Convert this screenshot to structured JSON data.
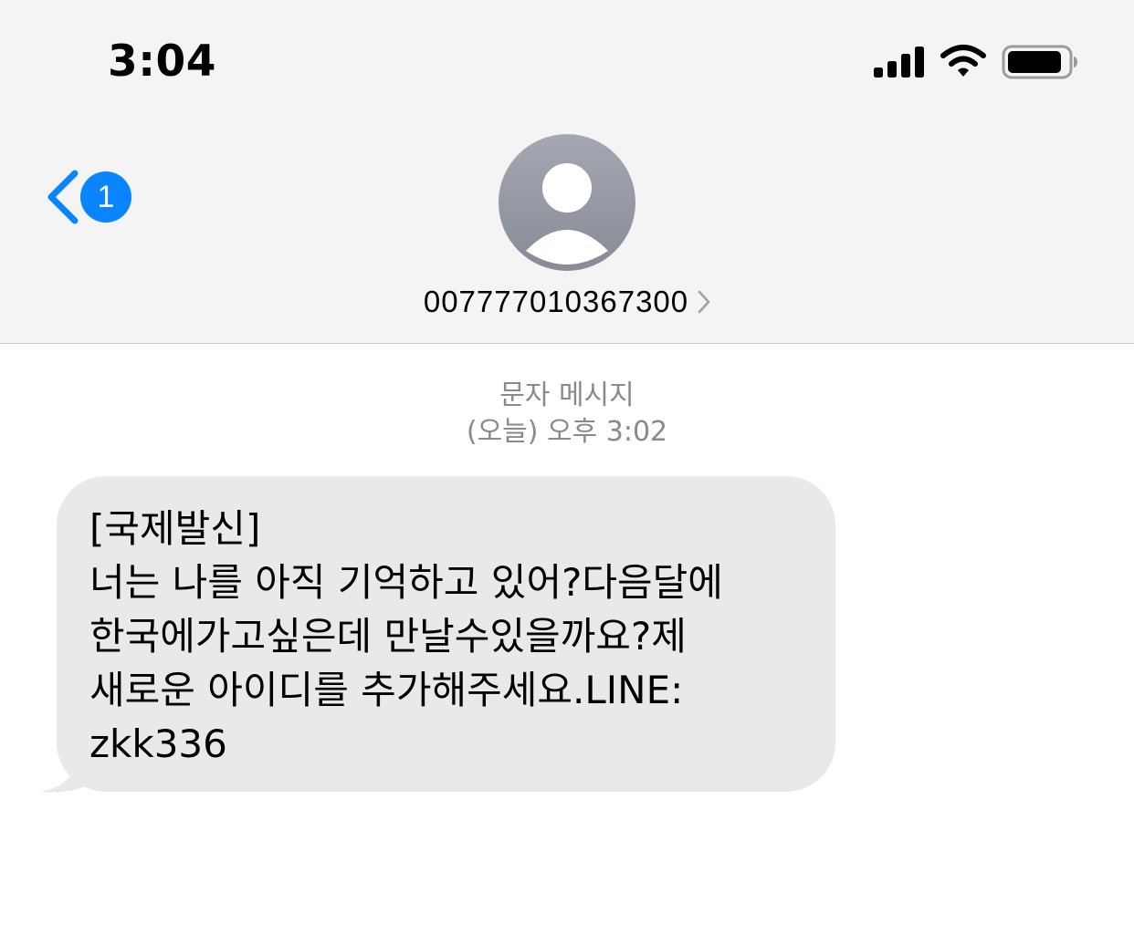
{
  "status_bar": {
    "time": "3:04",
    "signal_icon": "cellular-signal-icon",
    "wifi_icon": "wifi-icon",
    "battery_icon": "battery-icon"
  },
  "nav": {
    "back_icon": "chevron-left-icon",
    "unread_count": "1",
    "avatar_icon": "person-icon",
    "contact_number": "007777010367300",
    "contact_chevron_icon": "chevron-right-icon"
  },
  "thread": {
    "service_label": "문자 메시지",
    "timestamp": "(오늘) 오후 3:02"
  },
  "message": {
    "lines": [
      "[국제발신]",
      "너는 나를 아직 기억하고 있어?다음달에",
      "한국에가고싶은데 만날수있을까요?제",
      "새로운 아이디를 추가해주세요.LINE:",
      "zkk336"
    ]
  },
  "colors": {
    "accent": "#0a84ff",
    "header_bg": "#f4f4f5",
    "bubble_bg": "#e9e9eb",
    "meta_text": "#8a8a8e",
    "avatar_gradient_top": "#a5a8b2",
    "avatar_gradient_bottom": "#878b96"
  }
}
